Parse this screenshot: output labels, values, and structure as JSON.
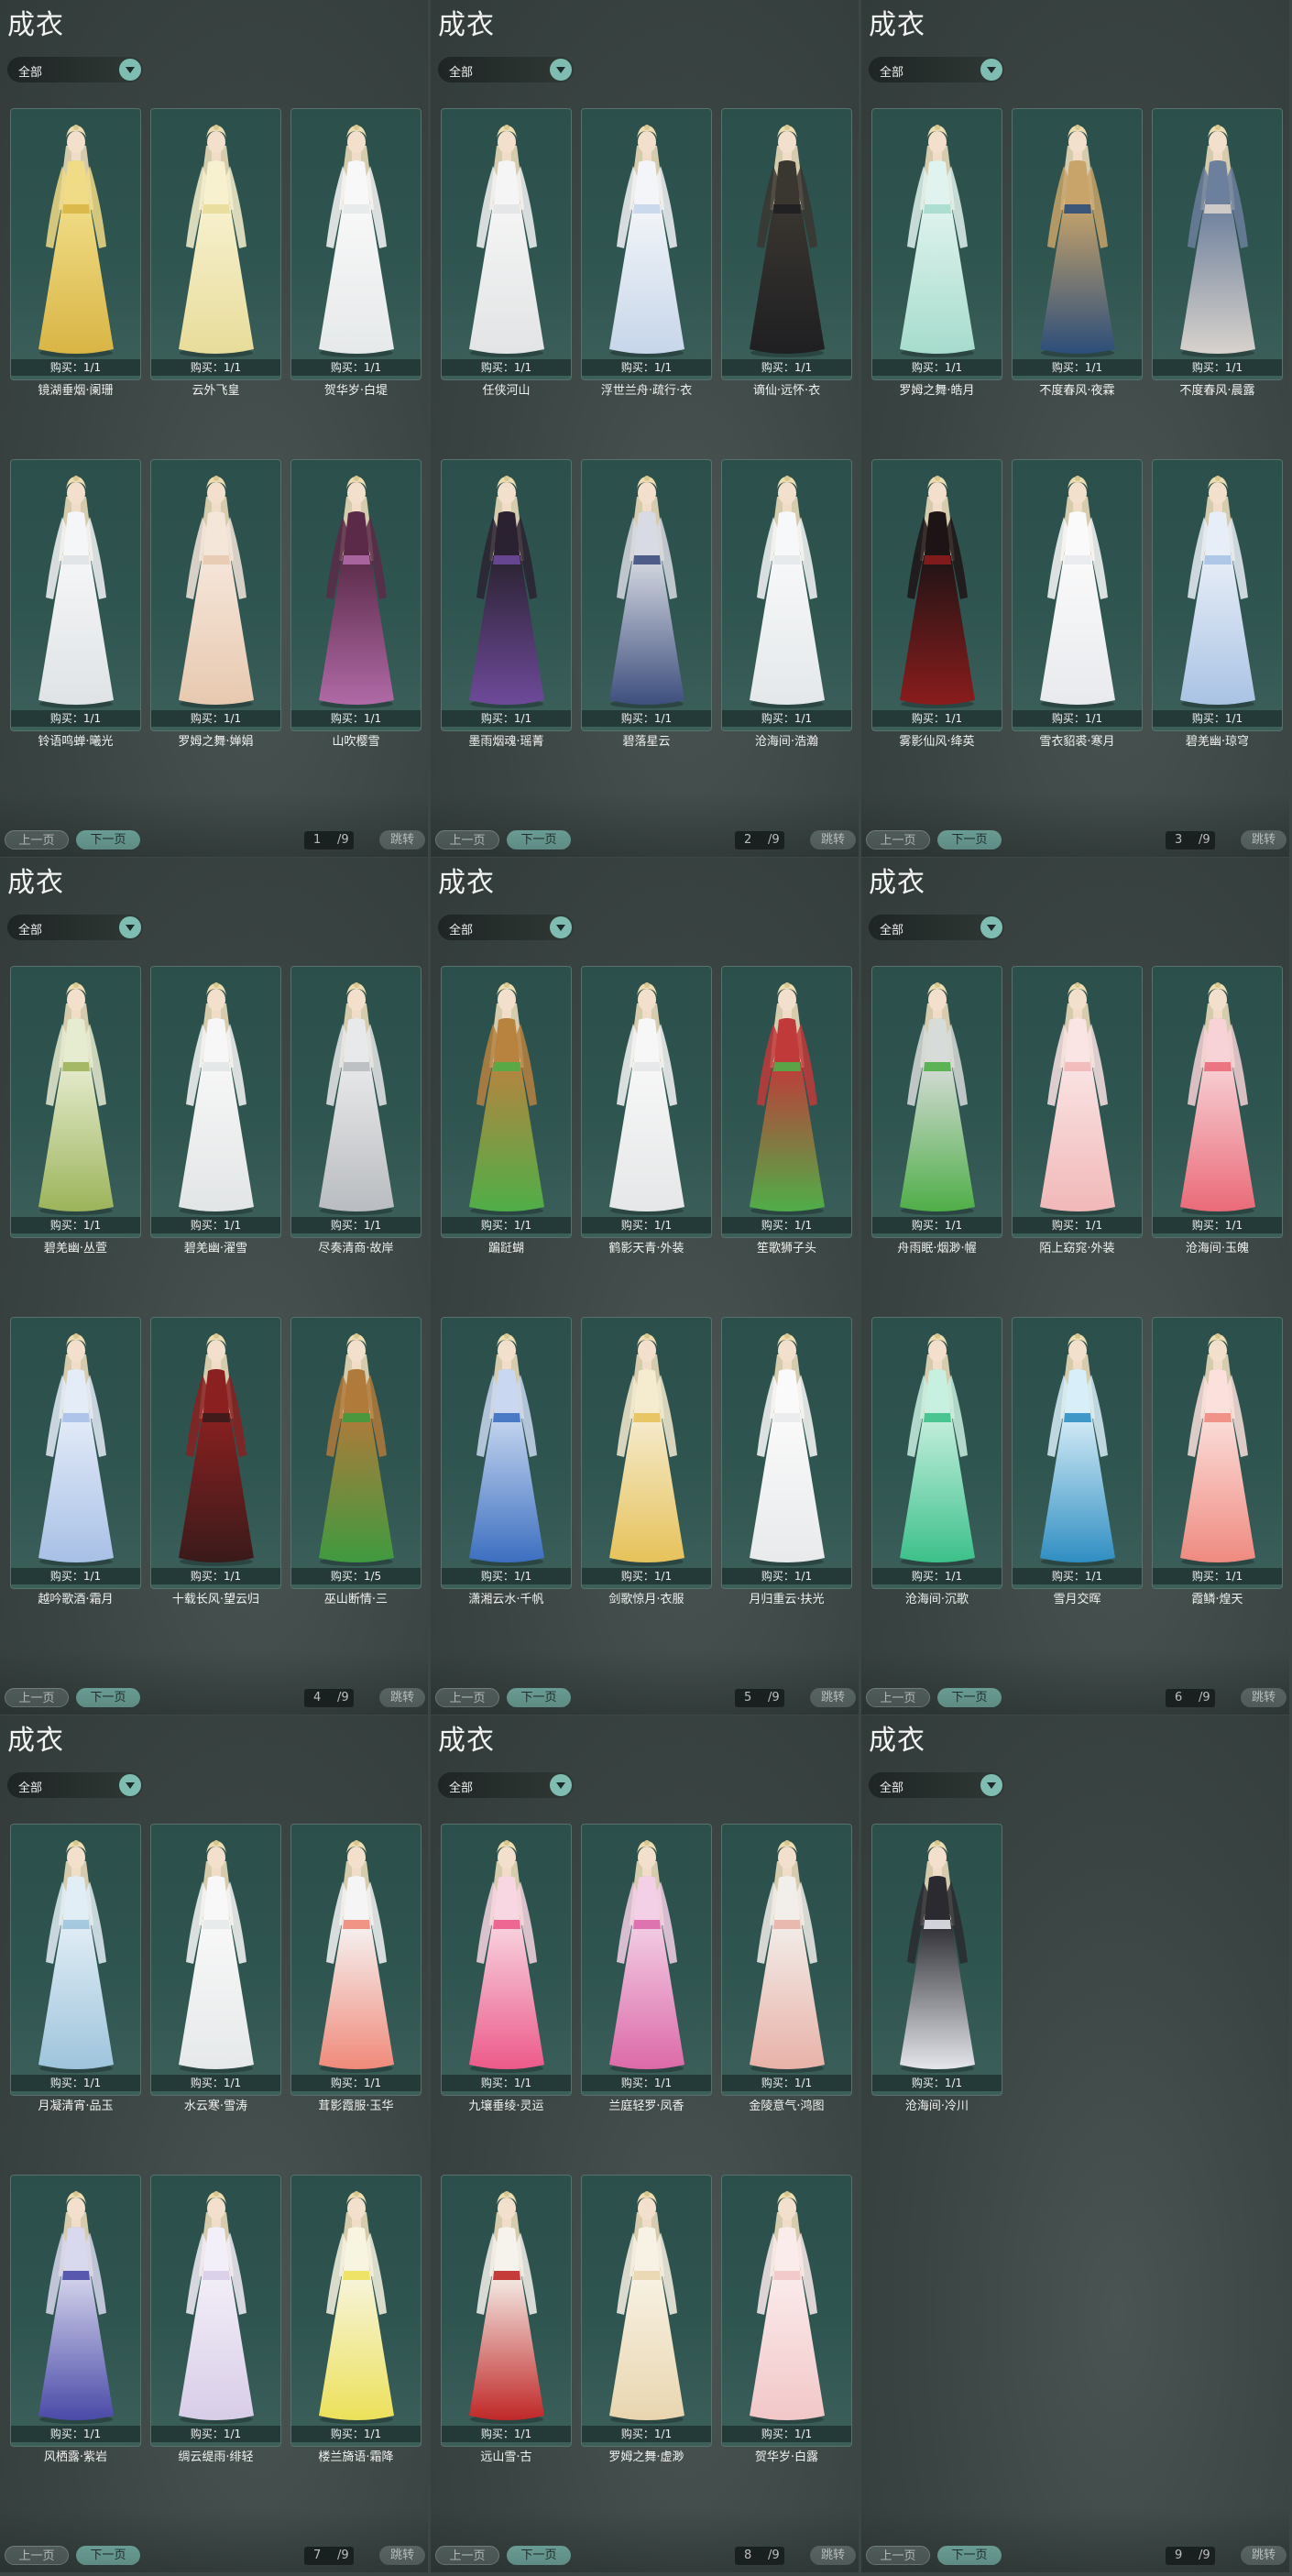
{
  "ui": {
    "title": "成衣",
    "filter_value": "全部",
    "prev_label": "上一页",
    "next_label": "下一页",
    "jump_label": "跳转",
    "total_pages": "/9",
    "accent_color": "#7fbdb2"
  },
  "panels": [
    {
      "page": "1",
      "items": [
        {
          "name": "镜湖垂烟·阑珊",
          "buy": "购买：1/1",
          "colors": [
            "#d9b545",
            "#f0dc86"
          ]
        },
        {
          "name": "云外飞皇",
          "buy": "购买：1/1",
          "colors": [
            "#e8dc9a",
            "#f7f1cf"
          ]
        },
        {
          "name": "贺华岁·白堤",
          "buy": "购买：1/1",
          "colors": [
            "#e6e9ea",
            "#f8f8f8"
          ]
        },
        {
          "name": "铃语鸣蝉·曦光",
          "buy": "购买：1/1",
          "colors": [
            "#dfe3e6",
            "#f5f6f7"
          ]
        },
        {
          "name": "罗姆之舞·婵娟",
          "buy": "购买：1/1",
          "colors": [
            "#e8c9b0",
            "#f5e6da"
          ]
        },
        {
          "name": "山吹樱雪",
          "buy": "购买：1/1",
          "colors": [
            "#b06aa6",
            "#5a2a48"
          ]
        }
      ]
    },
    {
      "page": "2",
      "items": [
        {
          "name": "任侠河山",
          "buy": "购买：1/1",
          "colors": [
            "#e2e4e5",
            "#f5f5f5"
          ]
        },
        {
          "name": "浮世兰舟·疏行·衣",
          "buy": "购买：1/1",
          "colors": [
            "#c7d6ea",
            "#f3f5f8"
          ]
        },
        {
          "name": "谪仙·远怀·衣",
          "buy": "购买：1/1",
          "colors": [
            "#1f1f22",
            "#3a3630"
          ]
        },
        {
          "name": "墨雨烟魂·瑶菁",
          "buy": "购买：1/1",
          "colors": [
            "#6e4a9a",
            "#2a2230"
          ]
        },
        {
          "name": "碧落星云",
          "buy": "购买：1/1",
          "colors": [
            "#3e4f7e",
            "#d8dbe3"
          ]
        },
        {
          "name": "沧海间·浩瀚",
          "buy": "购买：1/1",
          "colors": [
            "#e4e8ea",
            "#f7f8f9"
          ]
        }
      ]
    },
    {
      "page": "3",
      "items": [
        {
          "name": "罗姆之舞·皓月",
          "buy": "购买：1/1",
          "colors": [
            "#a6dccd",
            "#e0f3ee"
          ]
        },
        {
          "name": "不度春风·夜霖",
          "buy": "购买：1/1",
          "colors": [
            "#2c4e7a",
            "#c8a46a"
          ]
        },
        {
          "name": "不度春风·晨露",
          "buy": "购买：1/1",
          "colors": [
            "#d8d2cc",
            "#6c7f9c"
          ]
        },
        {
          "name": "雾影仙风·绛英",
          "buy": "购买：1/1",
          "colors": [
            "#8a1c1c",
            "#1e1416"
          ]
        },
        {
          "name": "雪衣貂裘·寒月",
          "buy": "购买：1/1",
          "colors": [
            "#e8eaee",
            "#fafafa"
          ]
        },
        {
          "name": "碧羌幽·琼穹",
          "buy": "购买：1/1",
          "colors": [
            "#a9c3e4",
            "#e8eef7"
          ]
        }
      ]
    },
    {
      "page": "4",
      "items": [
        {
          "name": "碧羌幽·丛萱",
          "buy": "购买：1/1",
          "colors": [
            "#9cb45a",
            "#e6ecd0"
          ]
        },
        {
          "name": "碧羌幽·濯雪",
          "buy": "购买：1/1",
          "colors": [
            "#e2e5e6",
            "#f7f7f7"
          ]
        },
        {
          "name": "尽奏清商·故岸",
          "buy": "购买：1/1",
          "colors": [
            "#b9bcc0",
            "#e8e9ea"
          ]
        },
        {
          "name": "越吟歌酒·霜月",
          "buy": "购买：1/1",
          "colors": [
            "#a8c0e6",
            "#e4ecf8"
          ]
        },
        {
          "name": "十载长风·望云归",
          "buy": "购买：1/1",
          "colors": [
            "#3a1a1a",
            "#8a2020"
          ]
        },
        {
          "name": "巫山断情·三",
          "buy": "购买：1/5",
          "colors": [
            "#3f9a3f",
            "#b07a3a"
          ]
        }
      ]
    },
    {
      "page": "5",
      "items": [
        {
          "name": "蹁跹蝴",
          "buy": "购买：1/1",
          "colors": [
            "#4fae48",
            "#b7833f"
          ]
        },
        {
          "name": "鹤影天青·外装",
          "buy": "购买：1/1",
          "colors": [
            "#e5e7e8",
            "#f7f7f7"
          ]
        },
        {
          "name": "笙歌狮子头",
          "buy": "购买：1/1",
          "colors": [
            "#4fae48",
            "#c13a3a"
          ]
        },
        {
          "name": "潇湘云水·千帆",
          "buy": "购买：1/1",
          "colors": [
            "#3c6fc0",
            "#c9d8f0"
          ]
        },
        {
          "name": "剑歌惊月·衣服",
          "buy": "购买：1/1",
          "colors": [
            "#e7c25a",
            "#f5ecd0"
          ]
        },
        {
          "name": "月归重云·扶光",
          "buy": "购买：1/1",
          "colors": [
            "#e8eaec",
            "#fafafa"
          ]
        }
      ]
    },
    {
      "page": "6",
      "items": [
        {
          "name": "舟雨眠·烟渺·幄",
          "buy": "购买：1/1",
          "colors": [
            "#4fae48",
            "#d7dcd9"
          ]
        },
        {
          "name": "陌上窈窕·外装",
          "buy": "购买：1/1",
          "colors": [
            "#f1b8b8",
            "#fae4e4"
          ]
        },
        {
          "name": "沧海间·玉魄",
          "buy": "购买：1/1",
          "colors": [
            "#ea6a78",
            "#f7d2d6"
          ]
        },
        {
          "name": "沧海间·沉歌",
          "buy": "购买：1/1",
          "colors": [
            "#3cc08a",
            "#c8f0e0"
          ]
        },
        {
          "name": "雪月交晖",
          "buy": "购买：1/1",
          "colors": [
            "#2f8ec2",
            "#d8eef8"
          ]
        },
        {
          "name": "霞鳞·煌天",
          "buy": "购买：1/1",
          "colors": [
            "#ef8a80",
            "#fbe0dc"
          ]
        }
      ]
    },
    {
      "page": "7",
      "items": [
        {
          "name": "月凝清宵·品玉",
          "buy": "购买：1/1",
          "colors": [
            "#9ec4dc",
            "#e2eef6"
          ]
        },
        {
          "name": "水云寒·雪涛",
          "buy": "购买：1/1",
          "colors": [
            "#e6e9ea",
            "#f8f8f8"
          ]
        },
        {
          "name": "茸影霞服·玉华",
          "buy": "购买：1/1",
          "colors": [
            "#f08a7a",
            "#f5f5f5"
          ]
        },
        {
          "name": "风栖露·紫岩",
          "buy": "购买：1/1",
          "colors": [
            "#4a4aa8",
            "#d8d8ee"
          ]
        },
        {
          "name": "绸云缇雨·绯轻",
          "buy": "购买：1/1",
          "colors": [
            "#d8cde8",
            "#f3eff8"
          ]
        },
        {
          "name": "楼兰旖语·霜降",
          "buy": "购买：1/1",
          "colors": [
            "#ece15a",
            "#f7f5e0"
          ]
        }
      ]
    },
    {
      "page": "8",
      "items": [
        {
          "name": "九壤垂绫·灵运",
          "buy": "购买：1/1",
          "colors": [
            "#ec5a8a",
            "#f8d6e2"
          ]
        },
        {
          "name": "兰庭轻罗·凤香",
          "buy": "购买：1/1",
          "colors": [
            "#dc6aa8",
            "#f3d0e6"
          ]
        },
        {
          "name": "金陵意气·鸿图",
          "buy": "购买：1/1",
          "colors": [
            "#e8b2a8",
            "#f2eeea"
          ]
        },
        {
          "name": "远山雪·古",
          "buy": "购买：1/1",
          "colors": [
            "#c02828",
            "#f6f2ec"
          ]
        },
        {
          "name": "罗姆之舞·虚渺",
          "buy": "购买：1/1",
          "colors": [
            "#e9d6b0",
            "#f8f2e4"
          ]
        },
        {
          "name": "贺华岁·白露",
          "buy": "购买：1/1",
          "colors": [
            "#f2c7c8",
            "#fbecec"
          ]
        }
      ]
    },
    {
      "page": "9",
      "items": [
        {
          "name": "沧海间·冷川",
          "buy": "购买：1/1",
          "colors": [
            "#e4e6ec",
            "#2a2a30"
          ]
        }
      ]
    }
  ]
}
